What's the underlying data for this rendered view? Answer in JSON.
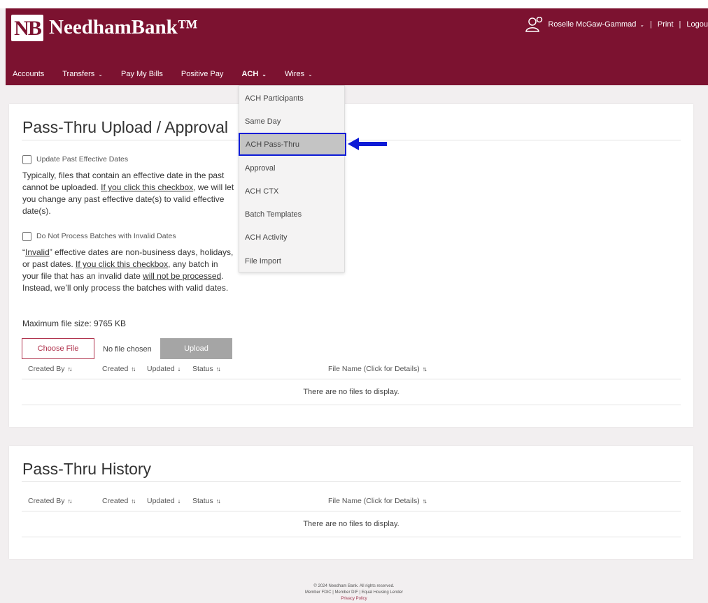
{
  "brand": {
    "logo_mark": "NB",
    "name": "NeedhamBank™"
  },
  "user": {
    "name": "Roselle McGaw-Gammad",
    "print": "Print",
    "logout": "Logou"
  },
  "nav": [
    {
      "label": "Accounts"
    },
    {
      "label": "Transfers"
    },
    {
      "label": "Pay My Bills"
    },
    {
      "label": "Positive Pay"
    },
    {
      "label": "ACH"
    },
    {
      "label": "Wires"
    }
  ],
  "dropdown": {
    "items": [
      "ACH Participants",
      "Same Day",
      "ACH Pass-Thru",
      "Approval",
      "ACH CTX",
      "Batch Templates",
      "ACH Activity",
      "File Import"
    ],
    "highlighted": "ACH Pass-Thru"
  },
  "upload": {
    "title": "Pass-Thru Upload / Approval",
    "option1": {
      "label": "Update Past Effective Dates",
      "desc1": "Typically, files that contain an effective date in the past cannot be uploaded. ",
      "desc_link": "If you click this checkbox",
      "desc2": ", we will let you change any past effective date(s) to valid effective date(s)."
    },
    "option2": {
      "label": "Do Not Process Batches with Invalid Dates",
      "q_open": "“",
      "invalid": "Invalid",
      "desc1": "” effective dates are non-business days, holidays, or past dates. ",
      "desc_link": "If you click this checkbox",
      "desc2": ", any batch in your file that has an invalid date ",
      "desc_link2": "will not be processed",
      "desc3": ". Instead, we’ll only process the batches with valid dates."
    },
    "max_size": "Maximum file size: 9765 KB",
    "choose_file": "Choose File",
    "no_file": "No file chosen",
    "upload_btn": "Upload",
    "columns": [
      "Created By",
      "Created",
      "Updated",
      "Status",
      "File Name (Click for Details)"
    ],
    "empty": "There are no files to display."
  },
  "history": {
    "title": "Pass-Thru History",
    "columns": [
      "Created By",
      "Created",
      "Updated",
      "Status",
      "File Name (Click for Details)"
    ],
    "empty": "There are no files to display."
  },
  "footer": {
    "line1": "© 2024 Needham Bank. All rights reserved.",
    "line2": "Member FDIC | Member DIF | Equal Housing Lender",
    "line3": "Privacy Policy"
  },
  "colors": {
    "brand": "#7c1230",
    "highlight_border": "#0d1bd6",
    "arrow": "#0d1bd6"
  }
}
